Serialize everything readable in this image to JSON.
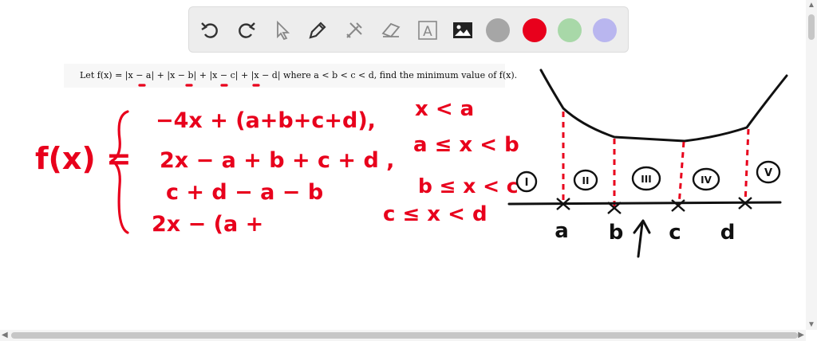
{
  "toolbar": {
    "tools": [
      {
        "name": "undo-icon"
      },
      {
        "name": "redo-icon"
      },
      {
        "name": "select-icon"
      },
      {
        "name": "pen-icon"
      },
      {
        "name": "tools-icon"
      },
      {
        "name": "eraser-icon"
      },
      {
        "name": "text-icon",
        "label": "A"
      },
      {
        "name": "image-icon"
      }
    ],
    "colors": [
      "#a6a6a6",
      "#e8001c",
      "#a8d8a8",
      "#b9b6ef"
    ]
  },
  "problem": {
    "text": "Let f(x) = |x − a| + |x − b| + |x − c| + |x − d| where a < b < c < d, find the minimum value of f(x)."
  },
  "board": {
    "lhs": "f(x) =",
    "cases": [
      {
        "expr": "−4x + (a+b+c+d),",
        "cond": "x < a"
      },
      {
        "expr": "2x − a + b + c + d ,",
        "cond": "a ≤ x < b"
      },
      {
        "expr": "c + d − a − b",
        "cond": "b ≤ x < c"
      },
      {
        "expr": "2x − (a +",
        "cond": "c ≤ x < d"
      }
    ],
    "regions": [
      "I",
      "II",
      "III",
      "IV",
      "V"
    ],
    "points": [
      "a",
      "b",
      "c",
      "d"
    ]
  },
  "scrollbar": {
    "left_arrow": "◀",
    "right_arrow": "▶",
    "up_arrow": "▲",
    "down_arrow": "▼"
  }
}
